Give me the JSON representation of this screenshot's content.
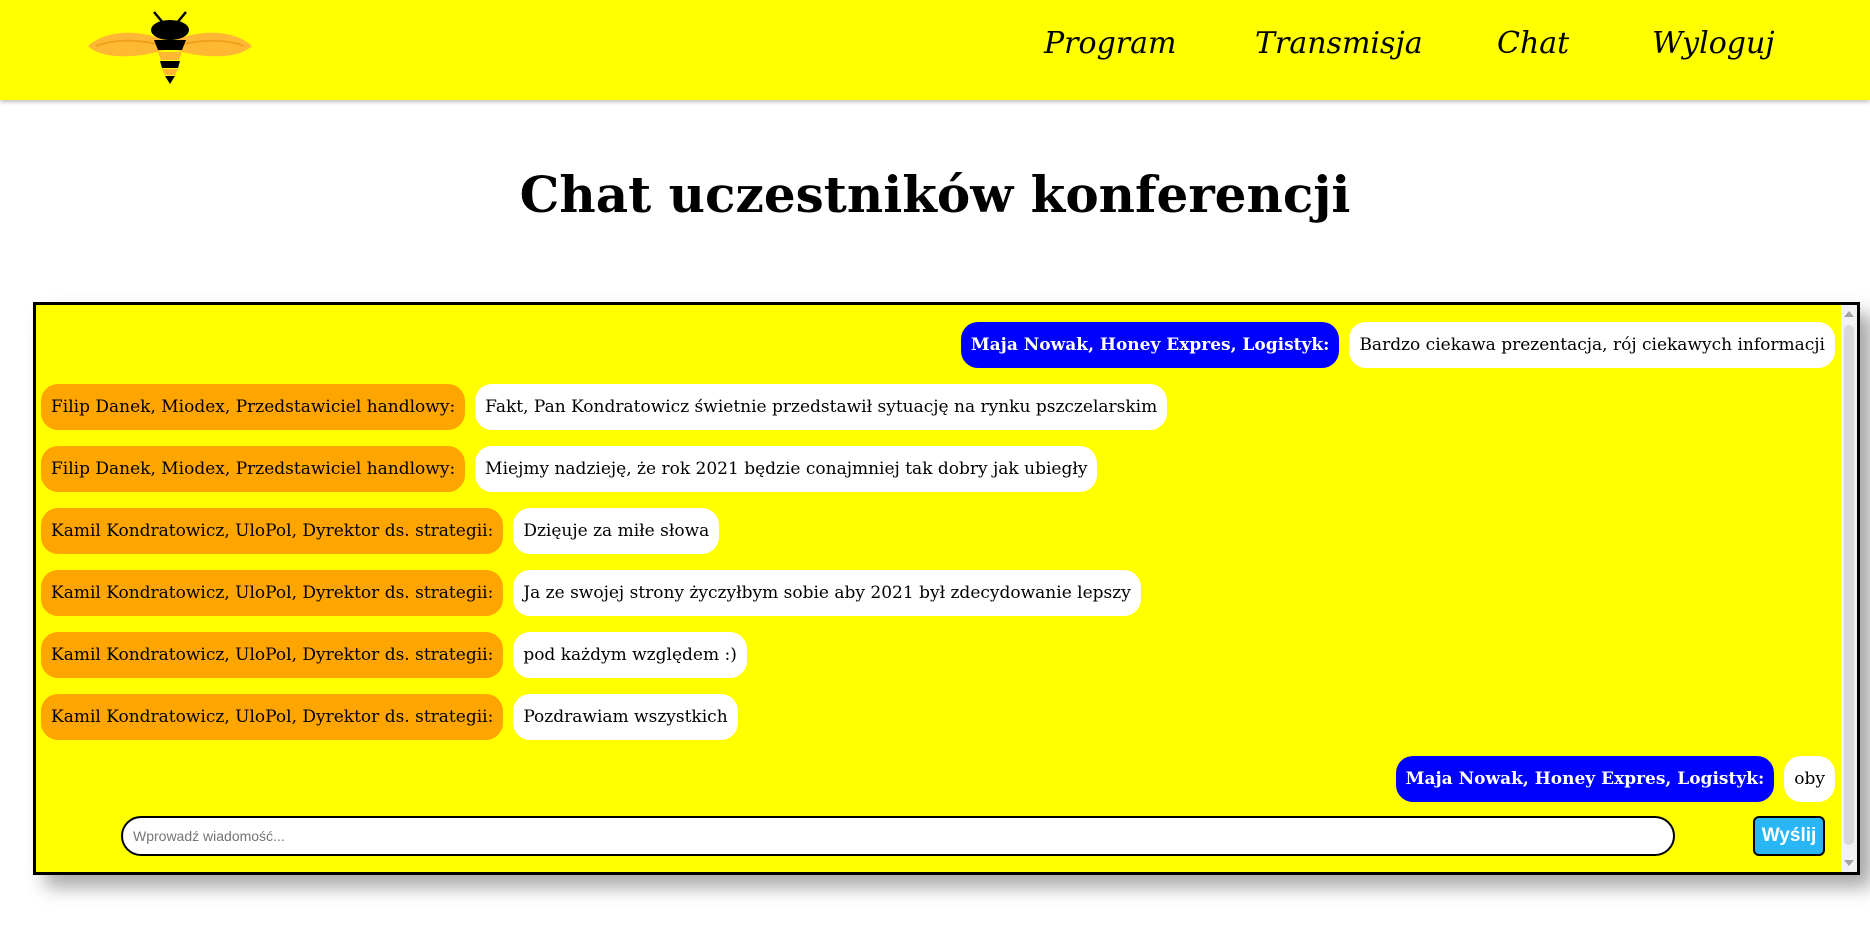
{
  "nav": {
    "program": "Program",
    "transmisja": "Transmisja",
    "chat": "Chat",
    "logout": "Wyloguj"
  },
  "page_title": "Chat uczestników konferencji",
  "messages": [
    {
      "side": "right",
      "sender": "Maja Nowak, Honey Expres, Logistyk:",
      "text": "Bardzo ciekawa prezentacja, rój ciekawych informacji"
    },
    {
      "side": "left",
      "sender": "Filip Danek, Miodex, Przedstawiciel handlowy:",
      "text": "Fakt, Pan Kondratowicz świetnie przedstawił sytuację na rynku pszczelarskim"
    },
    {
      "side": "left",
      "sender": "Filip Danek, Miodex, Przedstawiciel handlowy:",
      "text": "Miejmy nadzieję, że rok 2021 będzie conajmniej tak dobry jak ubiegły"
    },
    {
      "side": "left",
      "sender": "Kamil Kondratowicz, UloPol, Dyrektor ds. strategii:",
      "text": "Dzięuje za miłe słowa"
    },
    {
      "side": "left",
      "sender": "Kamil Kondratowicz, UloPol, Dyrektor ds. strategii:",
      "text": "Ja ze swojej strony życzyłbym sobie aby 2021 był zdecydowanie lepszy"
    },
    {
      "side": "left",
      "sender": "Kamil Kondratowicz, UloPol, Dyrektor ds. strategii:",
      "text": "pod każdym względem :)"
    },
    {
      "side": "left",
      "sender": "Kamil Kondratowicz, UloPol, Dyrektor ds. strategii:",
      "text": "Pozdrawiam wszystkich"
    },
    {
      "side": "right",
      "sender": "Maja Nowak, Honey Expres, Logistyk:",
      "text": "oby"
    }
  ],
  "input": {
    "placeholder": "Wprowadź wiadomość...",
    "value": ""
  },
  "send_label": "Wyślij",
  "colors": {
    "header_bg": "#ffff00",
    "chat_bg": "#ffff00",
    "other_sender_bg": "#ffa500",
    "own_sender_bg": "#0000ff",
    "bubble_bg": "#ffffff",
    "send_button_bg": "#29b6f6"
  }
}
